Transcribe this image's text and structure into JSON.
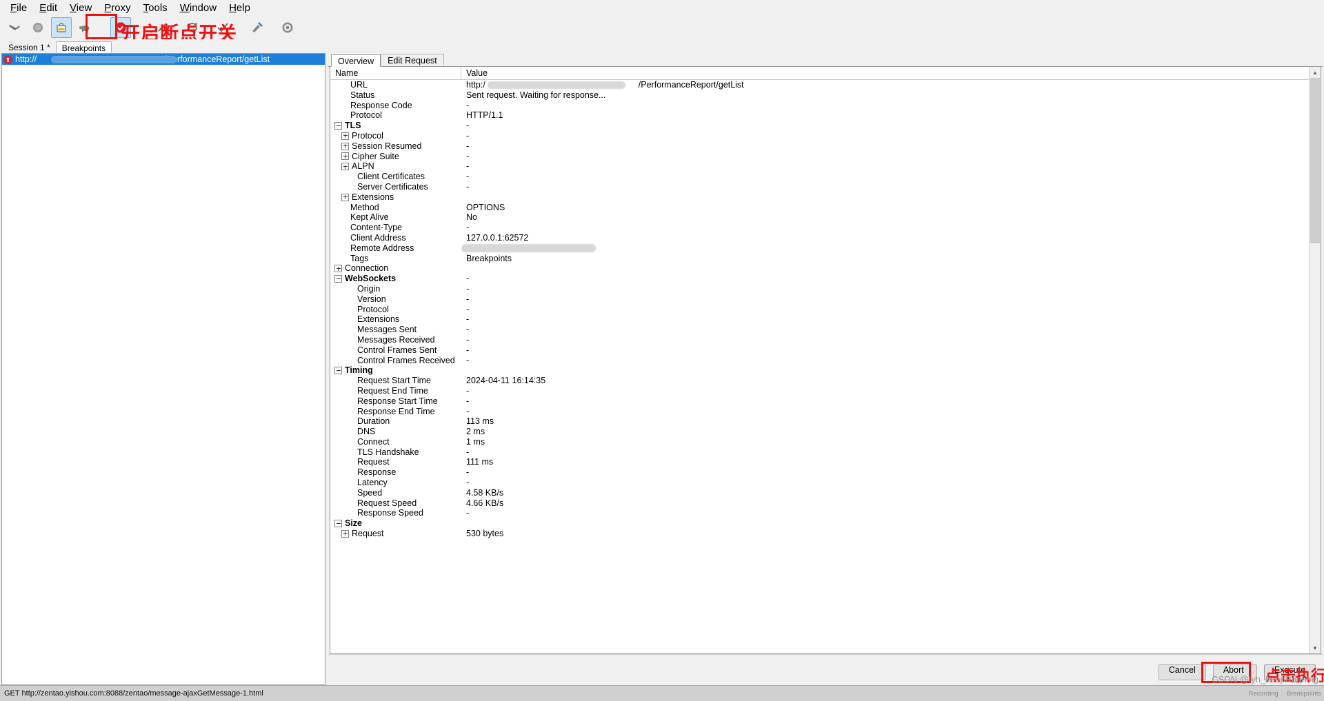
{
  "menu": {
    "items": [
      {
        "label": "File",
        "accel": "F"
      },
      {
        "label": "Edit",
        "accel": "E"
      },
      {
        "label": "View",
        "accel": "V"
      },
      {
        "label": "Proxy",
        "accel": "P"
      },
      {
        "label": "Tools",
        "accel": "T"
      },
      {
        "label": "Window",
        "accel": "W"
      },
      {
        "label": "Help",
        "accel": "H"
      }
    ]
  },
  "toolbar": {
    "buttons": [
      {
        "name": "clear-session-icon",
        "glyph": "broom"
      },
      {
        "name": "record-toggle-icon",
        "glyph": "record"
      },
      {
        "name": "throttle-icon",
        "glyph": "bucket"
      },
      {
        "name": "throttle-turtle-icon",
        "glyph": "turtle"
      },
      {
        "name": "breakpoints-toggle-icon",
        "glyph": "breakpoint"
      },
      {
        "name": "compose-icon",
        "glyph": "pen"
      },
      {
        "name": "repeat-icon",
        "glyph": "repeat"
      },
      {
        "name": "validate-icon",
        "glyph": "check"
      },
      {
        "name": "tools-icon",
        "glyph": "tools"
      },
      {
        "name": "settings-icon",
        "glyph": "gear"
      }
    ]
  },
  "annotations": {
    "breakpoint_toggle": "开启断点开关",
    "execute_hint": "点击执行"
  },
  "session_tabs": [
    {
      "label": "Session 1 *",
      "selected": false
    },
    {
      "label": "Breakpoints",
      "selected": true
    }
  ],
  "breakpoint_list": [
    {
      "url_prefix": "http://",
      "url_suffix": "/PerformanceReport/getList",
      "selected": true
    }
  ],
  "right_tabs": [
    {
      "label": "Overview",
      "selected": true
    },
    {
      "label": "Edit Request",
      "selected": false
    }
  ],
  "table": {
    "columns": {
      "name": "Name",
      "value": "Value"
    },
    "rows": [
      {
        "name": "URL",
        "value": "http:/",
        "value_suffix": "/PerformanceReport/getList",
        "indent": 1,
        "expander": "none",
        "bold": false,
        "redacted": true
      },
      {
        "name": "Status",
        "value": "Sent request. Waiting for response...",
        "indent": 1,
        "expander": "none",
        "bold": false
      },
      {
        "name": "Response Code",
        "value": "-",
        "indent": 1,
        "expander": "none",
        "bold": false
      },
      {
        "name": "Protocol",
        "value": "HTTP/1.1",
        "indent": 1,
        "expander": "none",
        "bold": false
      },
      {
        "name": "TLS",
        "value": "-",
        "indent": 0,
        "expander": "minus",
        "bold": true
      },
      {
        "name": "Protocol",
        "value": "-",
        "indent": 1,
        "expander": "plus",
        "bold": false
      },
      {
        "name": "Session Resumed",
        "value": "-",
        "indent": 1,
        "expander": "plus",
        "bold": false
      },
      {
        "name": "Cipher Suite",
        "value": "-",
        "indent": 1,
        "expander": "plus",
        "bold": false
      },
      {
        "name": "ALPN",
        "value": "-",
        "indent": 1,
        "expander": "plus",
        "bold": false
      },
      {
        "name": "Client Certificates",
        "value": "-",
        "indent": 2,
        "expander": "none",
        "bold": false
      },
      {
        "name": "Server Certificates",
        "value": "-",
        "indent": 2,
        "expander": "none",
        "bold": false
      },
      {
        "name": "Extensions",
        "value": "",
        "indent": 1,
        "expander": "plus",
        "bold": false
      },
      {
        "name": "Method",
        "value": "OPTIONS",
        "indent": 1,
        "expander": "none",
        "bold": false
      },
      {
        "name": "Kept Alive",
        "value": "No",
        "indent": 1,
        "expander": "none",
        "bold": false
      },
      {
        "name": "Content-Type",
        "value": "-",
        "indent": 1,
        "expander": "none",
        "bold": false
      },
      {
        "name": "Client Address",
        "value": "127.0.0.1:62572",
        "indent": 1,
        "expander": "none",
        "bold": false
      },
      {
        "name": "Remote Address",
        "value": "",
        "indent": 1,
        "expander": "none",
        "bold": false,
        "redacted": true
      },
      {
        "name": "Tags",
        "value": "Breakpoints",
        "indent": 1,
        "expander": "none",
        "bold": false
      },
      {
        "name": "Connection",
        "value": "",
        "indent": 0,
        "expander": "plus",
        "bold": false
      },
      {
        "name": "WebSockets",
        "value": "-",
        "indent": 0,
        "expander": "minus",
        "bold": true
      },
      {
        "name": "Origin",
        "value": "-",
        "indent": 2,
        "expander": "none",
        "bold": false
      },
      {
        "name": "Version",
        "value": "-",
        "indent": 2,
        "expander": "none",
        "bold": false
      },
      {
        "name": "Protocol",
        "value": "-",
        "indent": 2,
        "expander": "none",
        "bold": false
      },
      {
        "name": "Extensions",
        "value": "-",
        "indent": 2,
        "expander": "none",
        "bold": false
      },
      {
        "name": "Messages Sent",
        "value": "-",
        "indent": 2,
        "expander": "none",
        "bold": false
      },
      {
        "name": "Messages Received",
        "value": "-",
        "indent": 2,
        "expander": "none",
        "bold": false
      },
      {
        "name": "Control Frames Sent",
        "value": "-",
        "indent": 2,
        "expander": "none",
        "bold": false
      },
      {
        "name": "Control Frames Received",
        "value": "-",
        "indent": 2,
        "expander": "none",
        "bold": false
      },
      {
        "name": "Timing",
        "value": "",
        "indent": 0,
        "expander": "minus",
        "bold": true
      },
      {
        "name": "Request Start Time",
        "value": "2024-04-11 16:14:35",
        "indent": 2,
        "expander": "none",
        "bold": false
      },
      {
        "name": "Request End Time",
        "value": "-",
        "indent": 2,
        "expander": "none",
        "bold": false
      },
      {
        "name": "Response Start Time",
        "value": "-",
        "indent": 2,
        "expander": "none",
        "bold": false
      },
      {
        "name": "Response End Time",
        "value": "-",
        "indent": 2,
        "expander": "none",
        "bold": false
      },
      {
        "name": "Duration",
        "value": "113 ms",
        "indent": 2,
        "expander": "none",
        "bold": false
      },
      {
        "name": "DNS",
        "value": "2 ms",
        "indent": 2,
        "expander": "none",
        "bold": false
      },
      {
        "name": "Connect",
        "value": "1 ms",
        "indent": 2,
        "expander": "none",
        "bold": false
      },
      {
        "name": "TLS Handshake",
        "value": "-",
        "indent": 2,
        "expander": "none",
        "bold": false
      },
      {
        "name": "Request",
        "value": "111 ms",
        "indent": 2,
        "expander": "none",
        "bold": false
      },
      {
        "name": "Response",
        "value": "-",
        "indent": 2,
        "expander": "none",
        "bold": false
      },
      {
        "name": "Latency",
        "value": "-",
        "indent": 2,
        "expander": "none",
        "bold": false
      },
      {
        "name": "Speed",
        "value": "4.58 KB/s",
        "indent": 2,
        "expander": "none",
        "bold": false
      },
      {
        "name": "Request Speed",
        "value": "4.66 KB/s",
        "indent": 2,
        "expander": "none",
        "bold": false
      },
      {
        "name": "Response Speed",
        "value": "-",
        "indent": 2,
        "expander": "none",
        "bold": false
      },
      {
        "name": "Size",
        "value": "",
        "indent": 0,
        "expander": "minus",
        "bold": true
      },
      {
        "name": "Request",
        "value": "530 bytes",
        "indent": 1,
        "expander": "plus",
        "bold": false
      }
    ]
  },
  "buttons": {
    "cancel": "Cancel",
    "abort": "Abort",
    "execute": "Execute"
  },
  "statusbar": {
    "text": "GET http://zentao.yishou.com:8088/zentao/message-ajaxGetMessage-1.html",
    "recording": "Recording",
    "breakpoints": "Breakpoints"
  },
  "watermark": "CSDN @tyh_keepRunning"
}
